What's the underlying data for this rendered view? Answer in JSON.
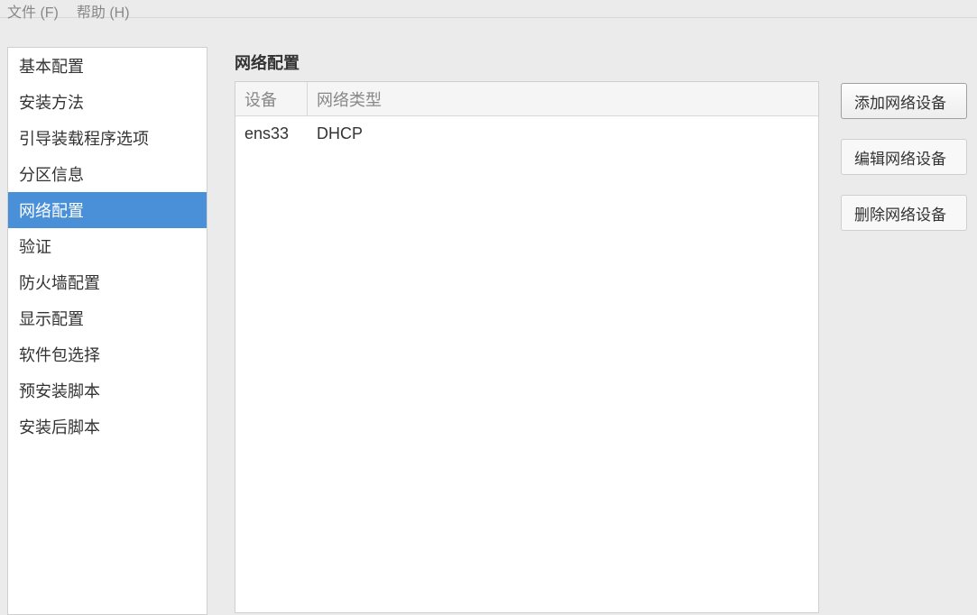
{
  "menubar": {
    "file": "文件 (F)",
    "help": "帮助 (H)"
  },
  "sidebar": {
    "items": [
      {
        "label": "基本配置",
        "selected": false
      },
      {
        "label": "安装方法",
        "selected": false
      },
      {
        "label": "引导装载程序选项",
        "selected": false
      },
      {
        "label": "分区信息",
        "selected": false
      },
      {
        "label": "网络配置",
        "selected": true
      },
      {
        "label": "验证",
        "selected": false
      },
      {
        "label": "防火墙配置",
        "selected": false
      },
      {
        "label": "显示配置",
        "selected": false
      },
      {
        "label": "软件包选择",
        "selected": false
      },
      {
        "label": "预安装脚本",
        "selected": false
      },
      {
        "label": "安装后脚本",
        "selected": false
      }
    ]
  },
  "main": {
    "title": "网络配置",
    "table": {
      "headers": {
        "device": "设备",
        "type": "网络类型"
      },
      "rows": [
        {
          "device": "ens33",
          "type": "DHCP"
        }
      ]
    },
    "actions": {
      "add": "添加网络设备",
      "edit": "编辑网络设备",
      "delete": "删除网络设备"
    }
  }
}
